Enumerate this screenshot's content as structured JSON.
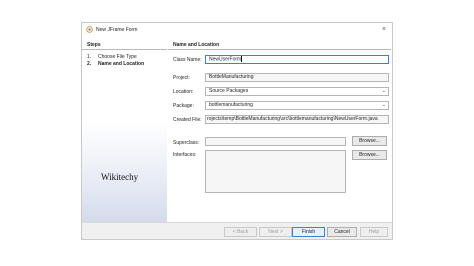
{
  "window": {
    "title": "New JFrame Form",
    "close_glyph": "×"
  },
  "steps": {
    "heading": "Steps",
    "items": [
      {
        "num": "1.",
        "label": "Choose File Type"
      },
      {
        "num": "2.",
        "label": "Name and Location"
      }
    ],
    "brand": "Wikitechy"
  },
  "content": {
    "heading": "Name and Location",
    "class_name_label": "Class Name:",
    "class_name_value": "NewUserForm",
    "project_label": "Project:",
    "project_value": "BottleManufacturing",
    "location_label": "Location:",
    "location_value": "Source Packages",
    "package_label": "Package:",
    "package_value": "bottlemanufacturing",
    "created_file_label": "Created File:",
    "created_file_value": "rojects\\temp\\BottleManufacturing\\src\\bottlemanufacturing\\NewUserForm.java",
    "superclass_label": "Superclass:",
    "interfaces_label": "Interfaces:",
    "browse_label": "Browse...",
    "dropdown_icon": "chevron-down-icon"
  },
  "footer": {
    "back_label": "< Back",
    "next_label": "Next >",
    "finish_label": "Finish",
    "cancel_label": "Cancel",
    "help_label": "Help"
  },
  "colors": {
    "accent": "#3b7fd9",
    "panel_gradient_end": "#d3dbeb"
  }
}
